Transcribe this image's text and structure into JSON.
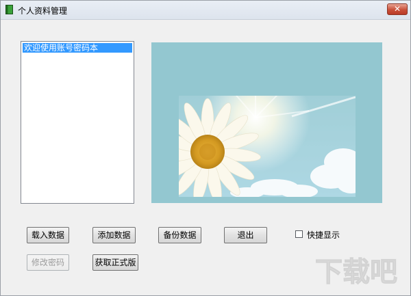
{
  "window": {
    "title": "个人资料管理",
    "close_label": "✕"
  },
  "list": {
    "items": [
      "欢迎使用账号密码本"
    ]
  },
  "buttons": {
    "load": "载入数据",
    "add": "添加数据",
    "backup": "备份数据",
    "exit": "退出",
    "change_password": "修改密码",
    "get_full_version": "获取正式版"
  },
  "options": {
    "quick_display_label": "快捷显示",
    "quick_display_checked": false
  },
  "watermark": {
    "text": "下载吧"
  }
}
